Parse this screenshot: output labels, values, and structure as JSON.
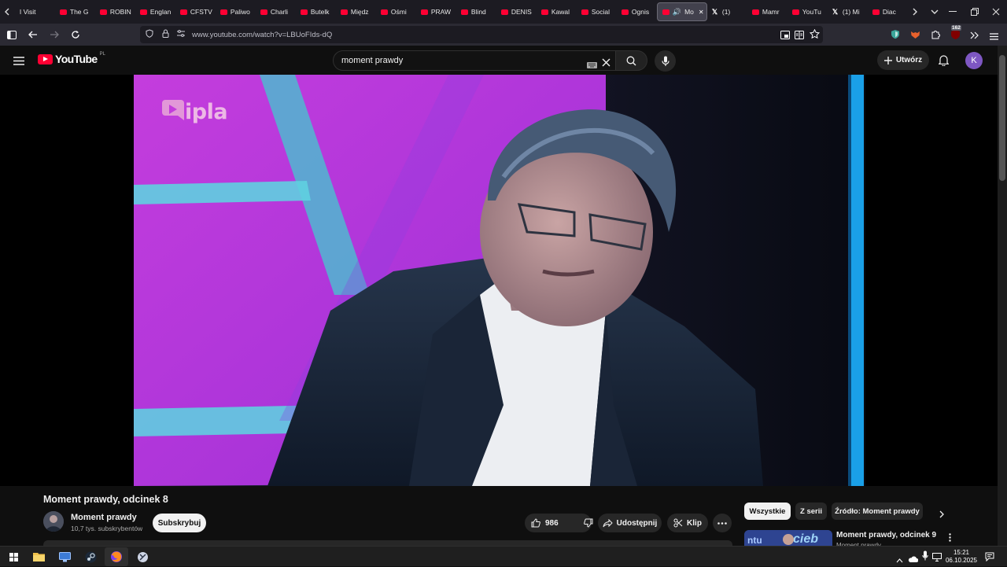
{
  "browser": {
    "tabs": [
      {
        "label": "I Visit",
        "icon": "none"
      },
      {
        "label": "The G",
        "icon": "youtube"
      },
      {
        "label": "ROBIN",
        "icon": "youtube"
      },
      {
        "label": "Englan",
        "icon": "youtube"
      },
      {
        "label": "CFSTV",
        "icon": "youtube"
      },
      {
        "label": "Paliwo",
        "icon": "youtube"
      },
      {
        "label": "Charli",
        "icon": "youtube"
      },
      {
        "label": "Butelk",
        "icon": "youtube"
      },
      {
        "label": "Międz",
        "icon": "youtube"
      },
      {
        "label": "Ośmi",
        "icon": "youtube"
      },
      {
        "label": "PRAW",
        "icon": "youtube"
      },
      {
        "label": "Blind",
        "icon": "youtube"
      },
      {
        "label": "DENIS",
        "icon": "youtube"
      },
      {
        "label": "Kawal",
        "icon": "youtube"
      },
      {
        "label": "Social",
        "icon": "youtube"
      },
      {
        "label": "Ognis",
        "icon": "youtube"
      },
      {
        "label": "Mo",
        "icon": "youtube",
        "active": true
      },
      {
        "label": "(1)",
        "icon": "x"
      },
      {
        "label": "Mamr",
        "icon": "youtube"
      },
      {
        "label": "YouTu",
        "icon": "youtube"
      },
      {
        "label": "(1) Mi",
        "icon": "x"
      },
      {
        "label": "Diac",
        "icon": "youtube"
      }
    ],
    "url": "www.youtube.com/watch?v=LBUoFIds-dQ",
    "extension_badge": "162"
  },
  "youtube": {
    "logo_text": "YouTube",
    "country_code": "PL",
    "search_value": "moment prawdy",
    "create_label": "Utwórz",
    "avatar_letter": "K",
    "accent": "#ff0033"
  },
  "video": {
    "watermark": "ipla",
    "title": "Moment prawdy, odcinek 8",
    "channel_name": "Moment prawdy",
    "subscribers": "10,7 tys. subskrybentów",
    "subscribe_label": "Subskrybuj",
    "likes": "986",
    "share_label": "Udostępnij",
    "clip_label": "Klip"
  },
  "sidebar": {
    "chips": [
      "Wszystkie",
      "Z serii",
      "Źródło: Moment prawdy"
    ],
    "recommended_title": "Moment prawdy, odcinek 9",
    "recommended_channel": "Moment prawdy"
  },
  "taskbar": {
    "time": "15:21",
    "date": "06.10.2025"
  }
}
